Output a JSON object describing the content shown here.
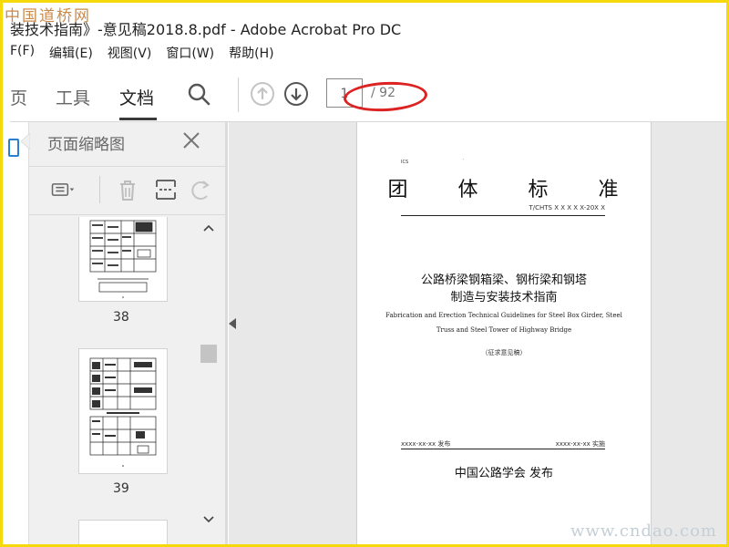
{
  "watermark": {
    "top": "中国道桥网",
    "bottom": "www.cndao.com"
  },
  "window": {
    "title": "装技术指南》-意见稿2018.8.pdf - Adobe Acrobat Pro DC"
  },
  "menu": {
    "items": [
      "F(F)",
      "编辑(E)",
      "视图(V)",
      "窗口(W)",
      "帮助(H)"
    ]
  },
  "toolbar": {
    "tabs": [
      "页",
      "工具",
      "文档"
    ],
    "active_tab": "文档",
    "current_page": "1",
    "total_pages": "/ 92"
  },
  "panel": {
    "title": "页面缩略图",
    "thumbnails": [
      {
        "label": "38"
      },
      {
        "label": "39"
      }
    ]
  },
  "document": {
    "ics": "ICS",
    "dot": ".",
    "title": "团 体 标 准",
    "code": "T/CHTS  X X X X X-20X X",
    "title_cn_line1": "公路桥梁钢箱梁、钢桁梁和钢塔",
    "title_cn_line2": "制造与安装技术指南",
    "title_en_line1": "Fabrication and Erection Technical Guidelines for Steel Box Girder, Steel",
    "title_en_line2": "Truss and Steel Tower of Highway Bridge",
    "draft": "（征求意见稿）",
    "issue_date": "xxxx-xx-xx 发布",
    "impl_date": "xxxx-xx-xx 实施",
    "publisher": "中国公路学会  发布"
  },
  "colors": {
    "annotation": "#dd2222",
    "page_bg": "#ffffff",
    "workspace_bg": "#e8e8e8"
  }
}
